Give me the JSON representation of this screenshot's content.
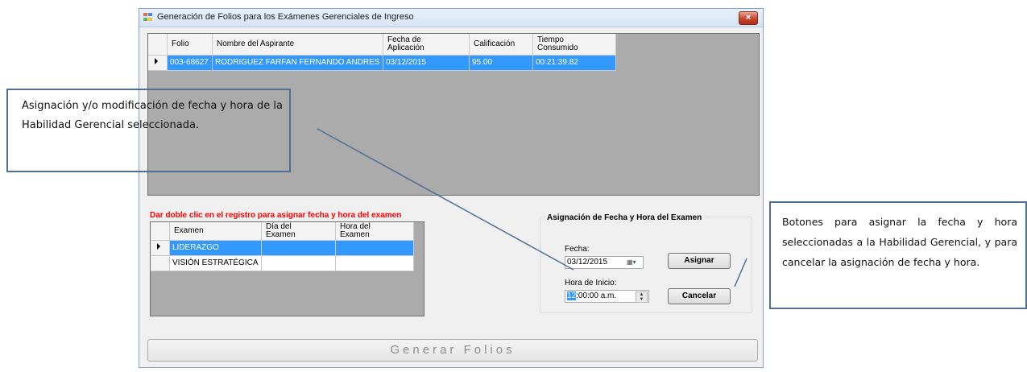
{
  "window": {
    "title": "Generación de Folios para los Exámenes Gerenciales de Ingreso",
    "close_label": "×"
  },
  "folios_grid": {
    "columns": [
      "Folio",
      "Nombre del Aspirante",
      "Fecha de\nAplicación",
      "Calificación",
      "Tiempo\nConsumido"
    ],
    "rows": [
      {
        "folio": "003-68627",
        "nombre": "RODRIGUEZ FARFAN FERNANDO ANDRES",
        "fecha": "03/12/2015",
        "calificacion": "95.00",
        "tiempo": "00:21:39.82",
        "selected": true
      }
    ]
  },
  "instruction": "Dar doble clic en el registro para asignar fecha y hora del examen",
  "exams_grid": {
    "columns": [
      "Examen",
      "Día del\nExamen",
      "Hora del\nExamen"
    ],
    "rows": [
      {
        "examen": "LIDERAZGO",
        "dia": "",
        "hora": "",
        "selected": true
      },
      {
        "examen": "VISIÓN ESTRATÉGICA",
        "dia": "",
        "hora": "",
        "selected": false
      }
    ]
  },
  "assignment": {
    "title": "Asignación de Fecha y Hora del Examen",
    "fecha_label": "Fecha:",
    "fecha_value": "03/12/2015",
    "hora_label": "Hora de Inicio:",
    "hora_value_highlight": "12",
    "hora_value_rest": ":00:00 a.m.",
    "assign_button": "Asignar",
    "cancel_button": "Cancelar"
  },
  "generate_button": "Generar Folios",
  "callouts": {
    "left": "Asignación y/o modificación de fecha y hora de la Habilidad Gerencial seleccionada.",
    "right": "Botones para asignar la fecha y hora seleccionadas a la Habilidad Gerencial, y para cancelar la asignación de fecha y hora."
  },
  "colors": {
    "selection": "#3399ff",
    "instruction": "#ff0000",
    "callout_border": "#4f6f95"
  },
  "icons": {
    "app": "app-icon",
    "close": "close-icon",
    "row_selector": "row-selector-arrow-icon",
    "calendar": "calendar-dropdown-icon",
    "spinner": "spinner-icon"
  }
}
